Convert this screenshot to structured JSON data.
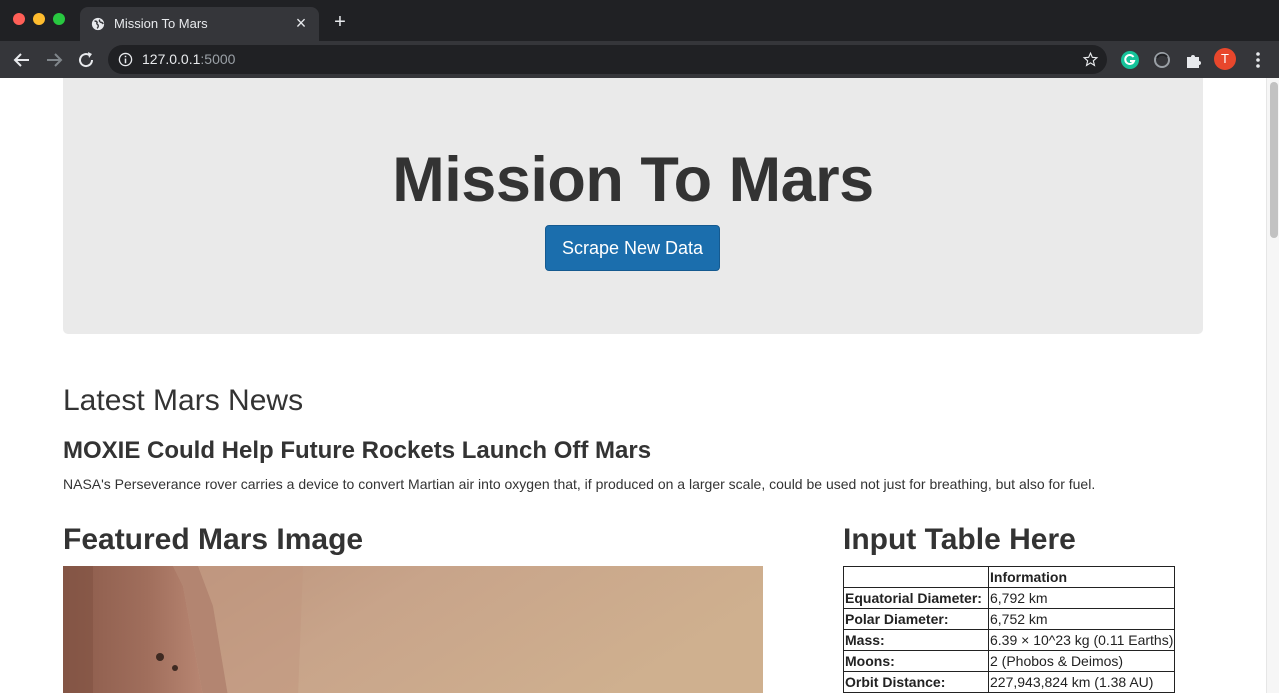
{
  "browser": {
    "tab_title": "Mission To Mars",
    "tab_close": "×",
    "new_tab": "+",
    "url_host": "127.0.0.1",
    "url_port": ":5000",
    "profile_initial": "T"
  },
  "jumbotron": {
    "title": "Mission To Mars",
    "button_label": "Scrape New Data"
  },
  "news": {
    "heading": "Latest Mars News",
    "title": "MOXIE Could Help Future Rockets Launch Off Mars",
    "paragraph": "NASA's Perseverance rover carries a device to convert Martian air into oxygen that, if produced on a larger scale, could be used not just for breathing, but also for fuel."
  },
  "featured_image": {
    "heading": "Featured Mars Image"
  },
  "facts_table": {
    "heading": "Input Table Here",
    "header": [
      "",
      "Information"
    ],
    "rows": [
      [
        "Equatorial Diameter:",
        "6,792 km"
      ],
      [
        "Polar Diameter:",
        "6,752 km"
      ],
      [
        "Mass:",
        "6.39 × 10^23 kg (0.11 Earths)"
      ],
      [
        "Moons:",
        "2 (Phobos & Deimos)"
      ],
      [
        "Orbit Distance:",
        "227,943,824 km (1.38 AU)"
      ]
    ]
  },
  "colors": {
    "button_blue": "#1b6ead",
    "jumbotron_bg": "#eaeaea",
    "chrome_dark": "#202124",
    "chrome_toolbar": "#35363a"
  }
}
